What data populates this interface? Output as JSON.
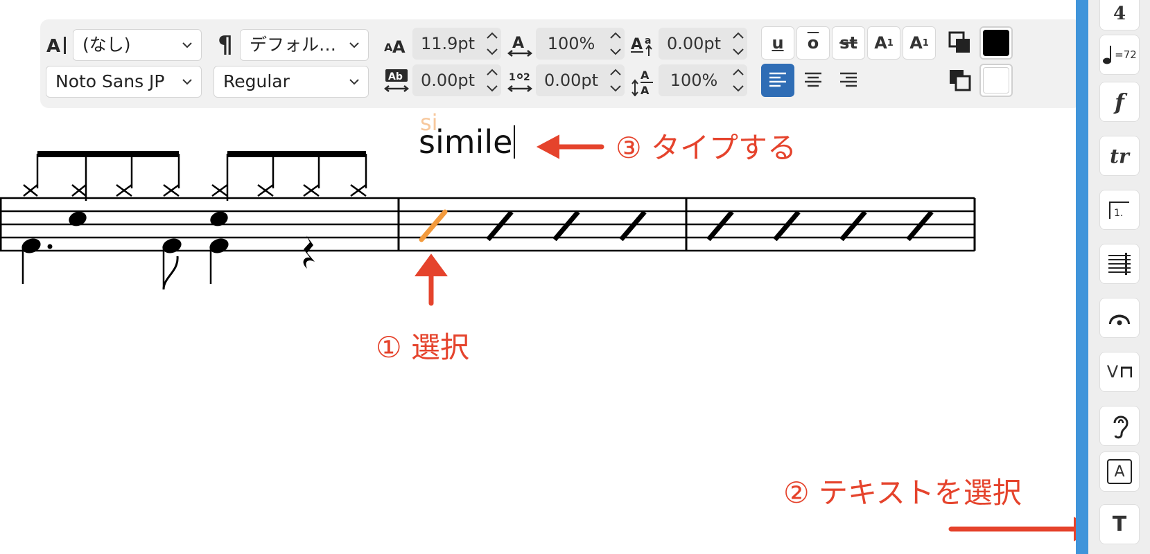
{
  "toolbar": {
    "style_select": "(なし)",
    "paragraph_select": "デフォル…",
    "font_family": "Noto Sans JP",
    "font_style": "Regular",
    "font_size": "11.9pt",
    "scale_width": "100%",
    "baseline_shift": "0.00pt",
    "letter_spacing": "0.00pt",
    "word_spacing": "0.00pt",
    "line_height": "100%",
    "format_buttons": {
      "underline": "u",
      "overline": "o",
      "strike": "st",
      "superscript": "A",
      "superscript_digit": "1",
      "subscript": "A",
      "subscript_digit": "1"
    },
    "colors": {
      "text_color": "#000000",
      "background_color": "#ffffff",
      "accent_active": "#2f6db5"
    }
  },
  "score": {
    "typed_text": "simile",
    "ghost_text": "si",
    "selected_note_color": "#f39a3c"
  },
  "annotations": {
    "step1": "① 選択",
    "step2": "② テキストを選択",
    "step3": "③ タイプする",
    "color": "#e5432c"
  },
  "palette": {
    "items": [
      {
        "icon": "time-signature-icon",
        "label": "4"
      },
      {
        "icon": "tempo-icon",
        "label": "=72"
      },
      {
        "icon": "dynamics-icon",
        "label": "f"
      },
      {
        "icon": "ornament-icon",
        "label": "tr"
      },
      {
        "icon": "volta-icon",
        "label": "1."
      },
      {
        "icon": "tremolo-icon",
        "label": ""
      },
      {
        "icon": "fermata-icon",
        "label": ""
      },
      {
        "icon": "bowing-icon",
        "label": "V"
      },
      {
        "icon": "ear-icon",
        "label": ""
      },
      {
        "icon": "text-frame-icon",
        "label": "A"
      },
      {
        "icon": "text-icon",
        "label": "T"
      }
    ]
  }
}
